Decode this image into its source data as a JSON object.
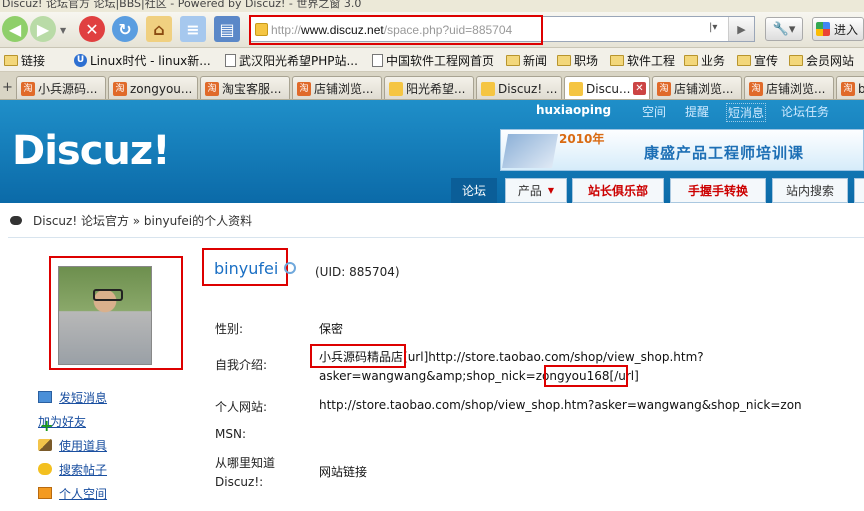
{
  "window": {
    "title": "Discuz! 论坛官方 论坛|BBS|社区 - Powered by Discuz! - 世界之窗 3.0"
  },
  "browser": {
    "url_prefix": "http://",
    "url_domain": "www.discuz.net",
    "url_path": "/space.php?uid=885704",
    "enter_label": "进入",
    "icons": [
      "back-icon",
      "forward-icon",
      "stop-icon",
      "refresh-icon",
      "home-icon",
      "history-icon",
      "bookmarks-icon",
      "tools-icon"
    ]
  },
  "bookmarks": [
    {
      "label": "链接",
      "icon": "folder"
    },
    {
      "label": "Linux时代 - linux新...",
      "icon": "u"
    },
    {
      "label": "武汉阳光希望PHP站...",
      "icon": "page"
    },
    {
      "label": "中国软件工程网首页",
      "icon": "page"
    },
    {
      "label": "新闻",
      "icon": "folder"
    },
    {
      "label": "职场",
      "icon": "folder"
    },
    {
      "label": "软件工程",
      "icon": "folder"
    },
    {
      "label": "业务",
      "icon": "folder"
    },
    {
      "label": "宣传",
      "icon": "folder"
    },
    {
      "label": "会员网站",
      "icon": "folder"
    }
  ],
  "tabs": [
    {
      "label": "小兵源码..."
    },
    {
      "label": "zongyou..."
    },
    {
      "label": "淘宝客服..."
    },
    {
      "label": "店铺浏览..."
    },
    {
      "label": "阳光希望..."
    },
    {
      "label": "Discuz! ..."
    },
    {
      "label": "Discu..."
    },
    {
      "label": "店铺浏览..."
    },
    {
      "label": "店铺浏览..."
    },
    {
      "label": "b"
    }
  ],
  "header": {
    "logo": "Discuz!",
    "username": "huxiaoping",
    "links": [
      "空间",
      "提醒",
      "短消息",
      "论坛任务"
    ],
    "banner_year": "2010年",
    "banner_text": "康盛产品工程师培训课",
    "nav": [
      "论坛",
      "产品",
      "站长俱乐部",
      "手握手转换",
      "站内搜索"
    ]
  },
  "breadcrumb": "Discuz! 论坛官方 » binyufei的个人资料",
  "profile": {
    "username": "binyufei",
    "uid": "(UID: 885704)",
    "fields": [
      {
        "label": "性别:",
        "value": "保密"
      },
      {
        "label": "自我介绍:",
        "value_line1_a": "小兵源码精品店",
        "value_line1_b": "[url]http://store.taobao.com/shop/view_shop.htm?",
        "value_line2_a": "asker=wangwang&amp;shop_nick=",
        "value_line2_b": "zongyou168",
        "value_line2_c": "[/url]"
      },
      {
        "label": "个人网站:",
        "value": "http://store.taobao.com/shop/view_shop.htm?asker=wangwang&shop_nick=zon"
      },
      {
        "label": "MSN:",
        "value": ""
      },
      {
        "label_line1": "从哪里知道",
        "label_line2": "Discuz!:",
        "value": "网站链接"
      }
    ],
    "actions": [
      "发短消息",
      "加为好友",
      "使用道具",
      "搜索帖子",
      "个人空间"
    ]
  }
}
